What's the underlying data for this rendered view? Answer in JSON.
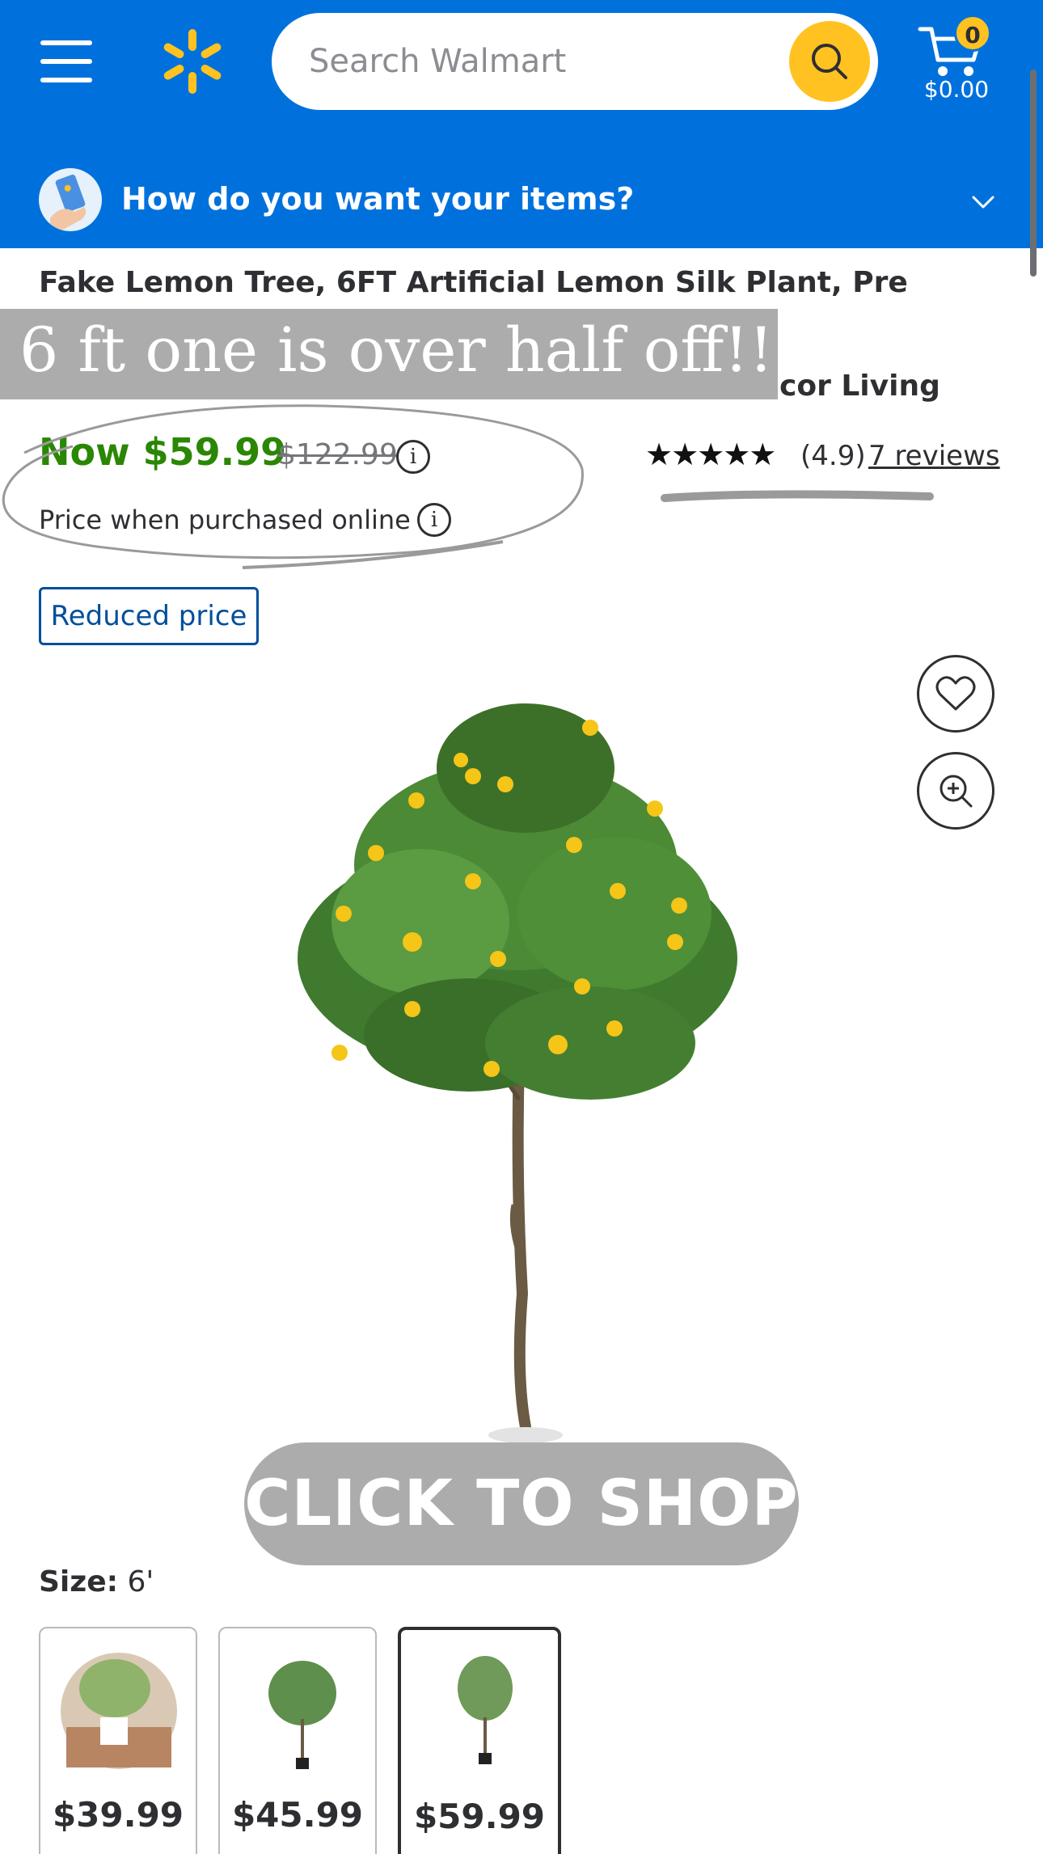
{
  "header": {
    "search_placeholder": "Search Walmart",
    "cart_count": "0",
    "cart_total": "$0.00",
    "fulfillment_prompt": "How do you want your items?",
    "brand_color": "#0071dc",
    "accent_color": "#ffc220"
  },
  "product": {
    "title_line1": "Fake Lemon Tree, 6FT Artificial Lemon Silk Plant, Pre Potted Faux",
    "title_line2_visible": "cor Living",
    "price_now": "Now $59.99",
    "price_was": "$122.99",
    "price_note": "Price when purchased online",
    "rating_value": "(4.9)",
    "reviews_link": "7 reviews",
    "stars": "★★★★★",
    "badge": "Reduced price",
    "price_color": "#2a8703"
  },
  "overlay": {
    "caption": "6 ft one is over half off!!",
    "cta": "CLICK TO SHOP"
  },
  "size": {
    "label": "Size:",
    "value": "6'",
    "variants": [
      {
        "price": "$39.99",
        "selected": false
      },
      {
        "price": "$45.99",
        "selected": false
      },
      {
        "price": "$59.99",
        "selected": true
      }
    ]
  },
  "icons": {
    "menu": "hamburger-icon",
    "logo": "spark-logo-icon",
    "search": "search-icon",
    "cart": "cart-icon",
    "fulfillment": "fulfillment-icon",
    "chevron": "chevron-down-icon",
    "info": "info-icon",
    "favorite": "heart-icon",
    "zoom": "zoom-in-icon"
  }
}
